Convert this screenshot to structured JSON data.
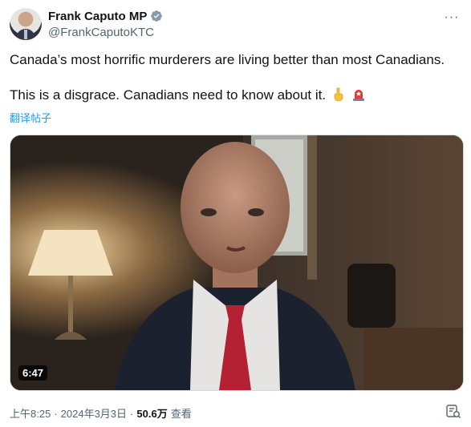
{
  "author": {
    "display_name": "Frank Caputo MP",
    "handle": "@FrankCaputoKTC"
  },
  "tweet": {
    "line1": "Canada’s most horrific murderers are living better than most Canadians.",
    "line2": "This is a disgrace. Canadians need to know about it.",
    "emojis": [
      "pointing-down-icon",
      "siren-icon"
    ],
    "translate_link": "翻译帖子"
  },
  "video": {
    "duration": "6:47"
  },
  "meta": {
    "time": "上午8:25",
    "sep1": "·",
    "date": "2024年3月3日",
    "sep2": "·",
    "views": "50.6万",
    "views_label": "查看"
  },
  "colors": {
    "accent": "#1d9bf0",
    "text": "#0f1419",
    "muted": "#536471"
  }
}
